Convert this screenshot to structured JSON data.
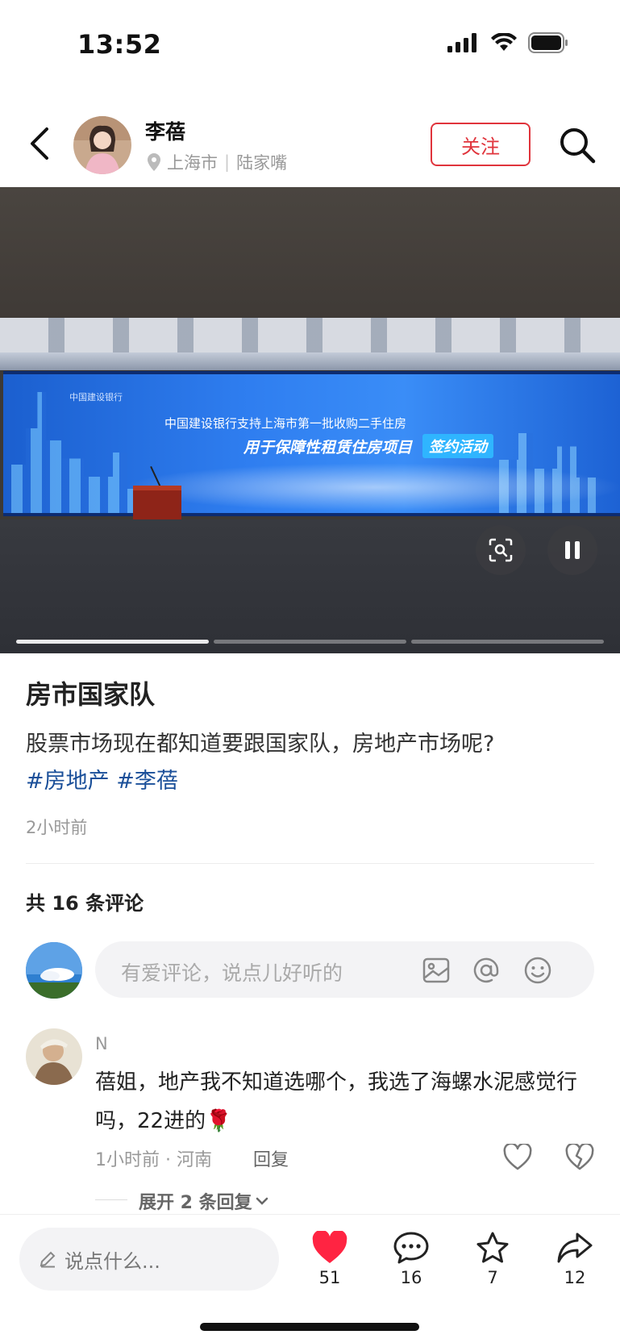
{
  "status_bar": {
    "time": "13:52"
  },
  "header": {
    "author_name": "李蓓",
    "location_city": "上海市",
    "location_separator": "|",
    "location_area": "陆家嘴",
    "follow_label": "关注"
  },
  "video": {
    "screen_logo": "中国建设银行",
    "screen_line1": "中国建设银行支持上海市第一批收购二手住房",
    "screen_line2": "用于保障性租赁住房项目",
    "screen_tag": "签约活动",
    "segments": 3,
    "current_segment": 1
  },
  "post": {
    "title": "房市国家队",
    "description": "股票市场现在都知道要跟国家队，房地产市场呢?",
    "hashtags": [
      "#房地产",
      "#李蓓"
    ],
    "time": "2小时前"
  },
  "comments": {
    "count_label": "共 16 条评论",
    "input_placeholder": "有爱评论，说点儿好听的",
    "items": [
      {
        "user": "N",
        "text": "蓓姐，地产我不知道选哪个，我选了海螺水泥感觉行吗，22进的🌹",
        "meta": "1小时前 · 河南",
        "reply_label": "回复",
        "expand_label": "展开 2 条回复"
      }
    ]
  },
  "bottom_bar": {
    "input_placeholder": "说点什么...",
    "likes": "51",
    "comments": "16",
    "favorites": "7",
    "shares": "12"
  },
  "colors": {
    "accent_red": "#e0343c",
    "hashtag_blue": "#1a4f99",
    "like_red": "#ff2442"
  }
}
